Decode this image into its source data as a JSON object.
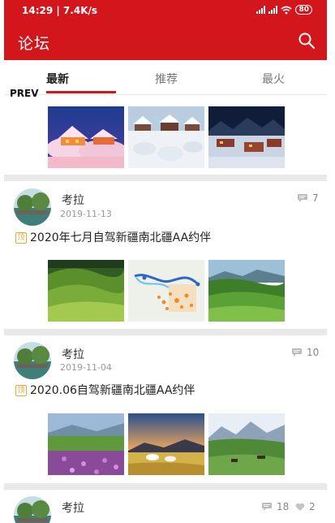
{
  "status": {
    "time_speed": "14:29 | 7.4K/s",
    "battery": "80"
  },
  "header": {
    "title": "论坛"
  },
  "tabs": [
    {
      "label": "最新"
    },
    {
      "label": "推荐"
    },
    {
      "label": "最火"
    }
  ],
  "prev_label": "PREV",
  "posts": [
    {
      "username": "考拉",
      "date": "2019-11-13",
      "pin_label": "顶",
      "title": "2020年七月自驾新疆南北疆AA约伴",
      "comment_count": "7"
    },
    {
      "username": "考拉",
      "date": "2019-11-04",
      "pin_label": "顶",
      "title": "2020.06自驾新疆南北疆AA约伴",
      "comment_count": "10"
    },
    {
      "username": "考拉",
      "comment_count": "18",
      "like_count": "2"
    }
  ],
  "colors": {
    "brand_red": "#d3161c",
    "pin_orange": "#e3a83a"
  }
}
